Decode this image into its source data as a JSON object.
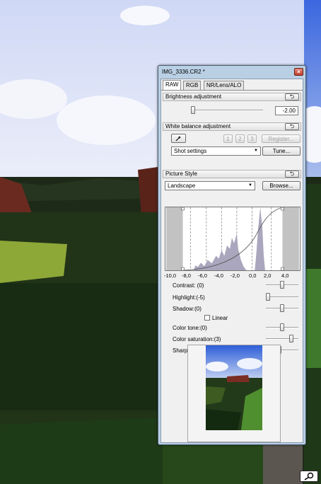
{
  "window": {
    "title": "IMG_3336.CR2 *",
    "close_glyph": "×"
  },
  "tabs": [
    {
      "label": "RAW",
      "active": true
    },
    {
      "label": "RGB",
      "active": false
    },
    {
      "label": "NR/Lens/ALO",
      "active": false
    }
  ],
  "brightness": {
    "header": "Brightness adjustment",
    "reset_glyph": "⮌",
    "value": "-2.00"
  },
  "white_balance": {
    "header": "White balance adjustment",
    "reset_glyph": "⮌",
    "eyedropper_icon": "eyedropper-icon",
    "presets": [
      "1",
      "2",
      "3"
    ],
    "register_label": "Register...",
    "selected": "Shot settings",
    "tune_label": "Tune..."
  },
  "picture_style": {
    "header": "Picture Style",
    "reset_glyph": "⮌",
    "selected": "Landscape",
    "browse_label": "Browse..."
  },
  "histogram": {
    "tick_labels": [
      "-10,0",
      "-8,0",
      "-6,0",
      "-4,0",
      "-2,0",
      "0,0",
      "2,0",
      "4,0"
    ]
  },
  "adjustments": {
    "contrast": {
      "label": "Contrast: (0)",
      "level": 0.5
    },
    "highlight": {
      "label": "Highlight:(-5)",
      "level": 0.0
    },
    "shadow": {
      "label": "Shadow:(0)",
      "level": 0.5
    },
    "linear": {
      "label": "Linear",
      "checked": false
    },
    "color_tone": {
      "label": "Color tone:(0)",
      "level": 0.5
    },
    "color_saturation": {
      "label": "Color saturation:(3)",
      "level": 0.83
    },
    "sharpness": {
      "label": "Sharpness:(4)",
      "level": 0.4
    }
  },
  "colors": {
    "accent": "#b9cfe4",
    "close": "#c4402c"
  },
  "icons": {
    "magnifier": "magnifier-icon"
  }
}
